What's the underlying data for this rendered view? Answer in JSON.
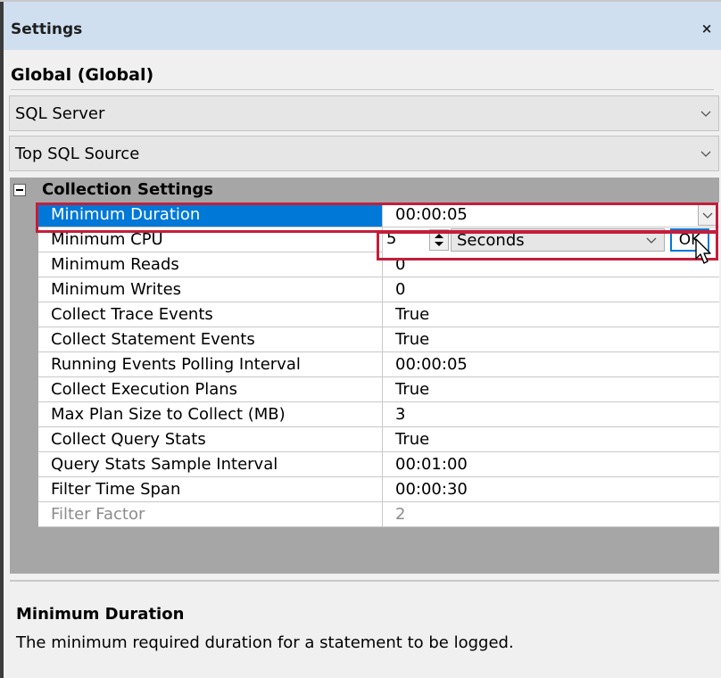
{
  "panel": {
    "title": "Settings",
    "close_glyph": "×"
  },
  "global": {
    "title": "Global (Global)"
  },
  "sections": [
    {
      "label": "SQL Server",
      "expanded": false
    },
    {
      "label": "Top SQL Source",
      "expanded": false
    }
  ],
  "category": {
    "label": "Collection Settings",
    "expanded": true,
    "rows": [
      {
        "name": "Minimum Duration",
        "value": "00:00:05",
        "selected": true
      },
      {
        "name": "Minimum CPU",
        "value": "5"
      },
      {
        "name": "Minimum Reads",
        "value": "0"
      },
      {
        "name": "Minimum Writes",
        "value": "0"
      },
      {
        "name": "Collect Trace Events",
        "value": "True"
      },
      {
        "name": "Collect Statement Events",
        "value": "True"
      },
      {
        "name": "Running Events Polling Interval",
        "value": "00:00:05"
      },
      {
        "name": "Collect Execution Plans",
        "value": "True"
      },
      {
        "name": "Max Plan Size to Collect (MB)",
        "value": "3"
      },
      {
        "name": "Collect Query Stats",
        "value": "True"
      },
      {
        "name": "Query Stats Sample Interval",
        "value": "00:01:00"
      },
      {
        "name": "Filter Time Span",
        "value": "00:00:30"
      },
      {
        "name": "Filter Factor",
        "value": "2",
        "disabled": true
      }
    ]
  },
  "editor": {
    "number_value": "5",
    "unit": "Seconds",
    "ok_label": "OK"
  },
  "description": {
    "title": "Minimum Duration",
    "text": "The minimum required duration for a statement to be logged."
  },
  "colors": {
    "title_bar": "#cfdff0",
    "selection": "#0078d7",
    "highlight": "#c41e3a",
    "category_header": "#a6a6a6"
  },
  "icons": [
    "close-icon",
    "chevron-down-icon",
    "collapse-icon",
    "spin-updown-icon",
    "mouse-cursor-icon"
  ]
}
